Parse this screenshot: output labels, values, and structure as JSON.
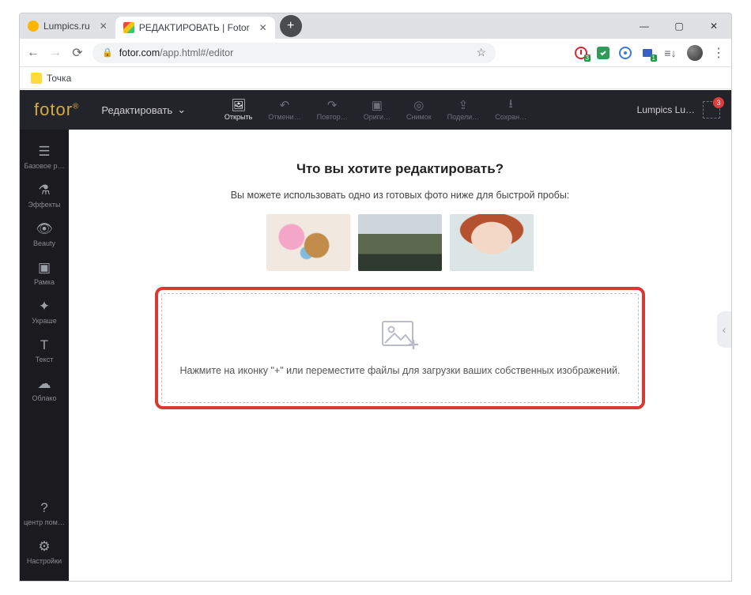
{
  "browser": {
    "tabs": [
      {
        "title": "Lumpics.ru",
        "active": false
      },
      {
        "title": "РЕДАКТИРОВАТЬ | Fotor",
        "active": true
      }
    ],
    "new_tab": "+",
    "win": {
      "min": "—",
      "max": "▢",
      "close": "✕"
    },
    "url_host": "fotor.com",
    "url_path": "/app.html#/editor",
    "bookmark": "Точка",
    "star": "☆",
    "ext_badges": {
      "a": "3",
      "b": "1"
    }
  },
  "app": {
    "logo": "fotor",
    "mode": "Редактировать",
    "toolbar": {
      "open": "Открыть",
      "undo": "Отмени…",
      "redo": "Повтор…",
      "original": "Ориги…",
      "snapshot": "Снимок",
      "share": "Подели…",
      "save": "Сохран…"
    },
    "user": {
      "name": "Lumpics Lu…",
      "badge": "3"
    },
    "sidebar": {
      "basic": "Базовое р…",
      "effects": "Эффекты",
      "beauty": "Beauty",
      "frame": "Рамка",
      "stickers": "Украше",
      "text": "Текст",
      "cloud": "Облако",
      "help": "центр пом…",
      "settings": "Настройки"
    }
  },
  "canvas": {
    "heading": "Что вы хотите редактировать?",
    "sub": "Вы можете использовать одно из готовых фото ниже для быстрой пробы:",
    "drop": "Нажмите на иконку \"+\" или переместите файлы для загрузки ваших собственных изображений."
  }
}
